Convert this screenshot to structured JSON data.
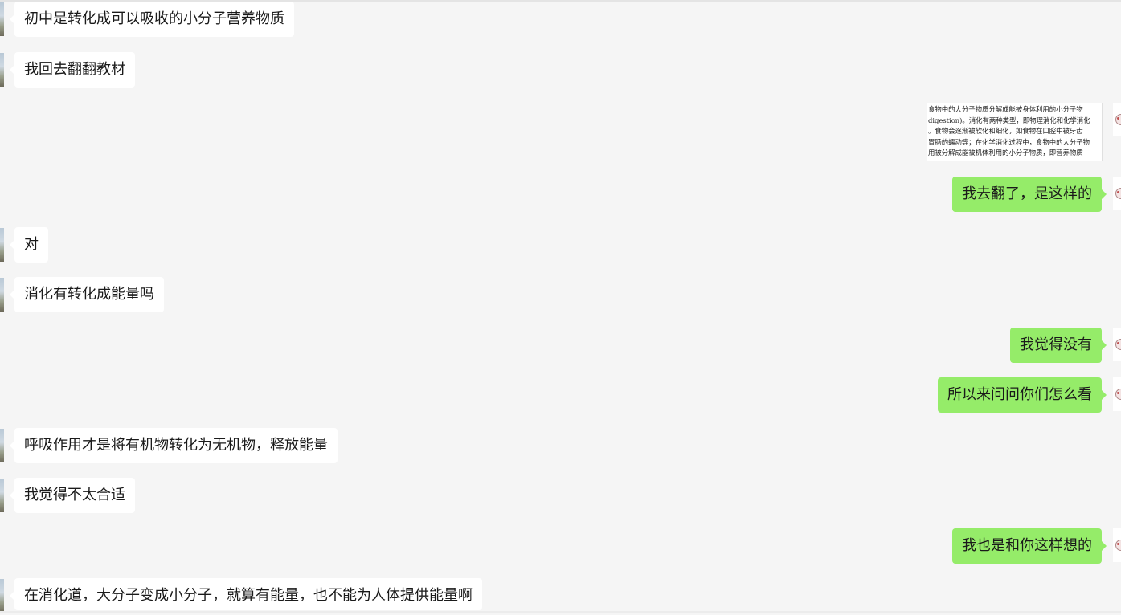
{
  "messages": [
    {
      "side": "in",
      "text": "初中是转化成可以吸收的小分子营养物质"
    },
    {
      "side": "in",
      "text": "我回去翻翻教材"
    },
    {
      "side": "out",
      "type": "image",
      "image_lines": [
        "食物中的大分子物质分解成能被身体利用的小分子物",
        "digestion)。消化有两种类型，即物理消化和化学消化",
        "。食物会逐渐被软化和细化，如食物在口腔中被牙齿",
        "胃肠的蠕动等；在化学消化过程中，食物中的大分子物",
        "用被分解成能被机体利用的小分子物质，即营养物质"
      ]
    },
    {
      "side": "out",
      "text": "我去翻了，是这样的"
    },
    {
      "side": "in",
      "text": "对"
    },
    {
      "side": "in",
      "text": "消化有转化成能量吗"
    },
    {
      "side": "out",
      "text": "我觉得没有"
    },
    {
      "side": "out",
      "text": "所以来问问你们怎么看"
    },
    {
      "side": "in",
      "text": "呼吸作用才是将有机物转化为无机物，释放能量"
    },
    {
      "side": "in",
      "text": "我觉得不太合适"
    },
    {
      "side": "out",
      "text": "我也是和你这样想的"
    },
    {
      "side": "in",
      "text": "在消化道，大分子变成小分子，就算有能量，也不能为人体提供能量啊"
    }
  ],
  "icons": {
    "incoming_avatar": "landscape-avatar-icon",
    "outgoing_avatar": "cartoon-avatar-icon"
  },
  "colors": {
    "background": "#f5f5f5",
    "incoming_bubble": "#ffffff",
    "outgoing_bubble": "#95ec69"
  }
}
